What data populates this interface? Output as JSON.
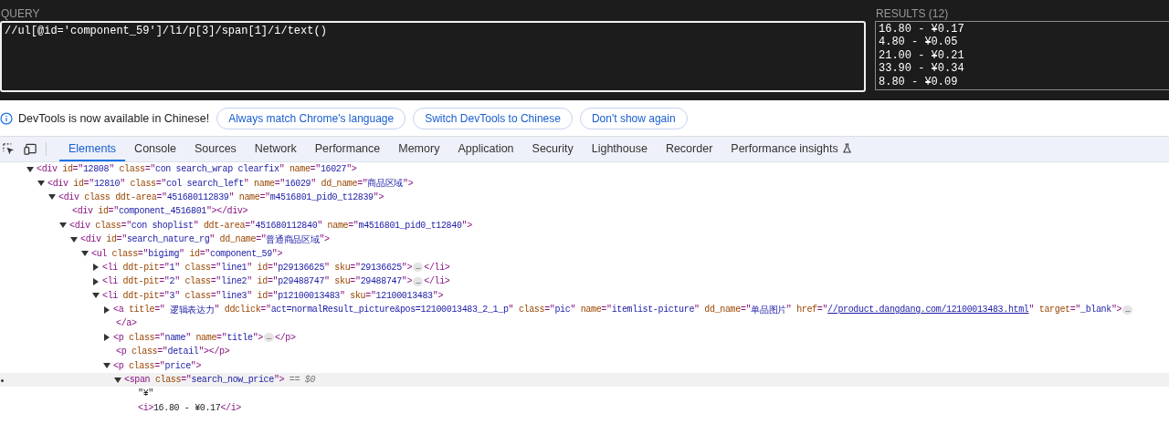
{
  "xpath_helper": {
    "query_label": "QUERY",
    "query": "//ul[@id='component_59']/li/p[3]/span[1]/i/text()",
    "results_label": "RESULTS (12)",
    "results": [
      "16.80 - ¥0.17",
      "4.80 - ¥0.05",
      "21.00 - ¥0.21",
      "33.90 - ¥0.34",
      "8.80 - ¥0.09"
    ]
  },
  "infobar": {
    "message": "DevTools is now available in Chinese!",
    "buttons": [
      "Always match Chrome's language",
      "Switch DevTools to Chinese",
      "Don't show again"
    ]
  },
  "tabs": [
    {
      "label": "Elements",
      "selected": true,
      "kind": "plain"
    },
    {
      "label": "Console",
      "selected": false,
      "kind": "plain"
    },
    {
      "label": "Sources",
      "selected": false,
      "kind": "plain"
    },
    {
      "label": "Network",
      "selected": false,
      "kind": "plain"
    },
    {
      "label": "Performance",
      "selected": false,
      "kind": "plain"
    },
    {
      "label": "Memory",
      "selected": false,
      "kind": "plain"
    },
    {
      "label": "Application",
      "selected": false,
      "kind": "plain"
    },
    {
      "label": "Security",
      "selected": false,
      "kind": "plain"
    },
    {
      "label": "Lighthouse",
      "selected": false,
      "kind": "plain"
    },
    {
      "label": "Recorder",
      "selected": false,
      "kind": "plain"
    },
    {
      "label": "Performance insights",
      "selected": false,
      "kind": "experimental"
    }
  ],
  "dom_tree": [
    {
      "expanded": true,
      "selected": false,
      "parts": [
        {
          "kind": "tag",
          "text": "<div"
        },
        {
          "kind": "attr",
          "text": " id"
        },
        {
          "kind": "punct",
          "text": "=\""
        },
        {
          "kind": "value",
          "text": "12808"
        },
        {
          "kind": "punct",
          "text": "\""
        },
        {
          "kind": "attr",
          "text": " class"
        },
        {
          "kind": "punct",
          "text": "=\""
        },
        {
          "kind": "value",
          "text": "con search_wrap clearfix"
        },
        {
          "kind": "punct",
          "text": "\""
        },
        {
          "kind": "attr",
          "text": " name"
        },
        {
          "kind": "punct",
          "text": "=\""
        },
        {
          "kind": "value",
          "text": "16027"
        },
        {
          "kind": "punct",
          "text": "\""
        },
        {
          "kind": "tag",
          "text": ">"
        }
      ],
      "children": [
        {
          "expanded": true,
          "selected": false,
          "parts": [
            {
              "kind": "tag",
              "text": "<div"
            },
            {
              "kind": "attr",
              "text": " id"
            },
            {
              "kind": "punct",
              "text": "=\""
            },
            {
              "kind": "value",
              "text": "12810"
            },
            {
              "kind": "punct",
              "text": "\""
            },
            {
              "kind": "attr",
              "text": " class"
            },
            {
              "kind": "punct",
              "text": "=\""
            },
            {
              "kind": "value",
              "text": "col search_left"
            },
            {
              "kind": "punct",
              "text": "\""
            },
            {
              "kind": "attr",
              "text": " name"
            },
            {
              "kind": "punct",
              "text": "=\""
            },
            {
              "kind": "value",
              "text": "16029"
            },
            {
              "kind": "punct",
              "text": "\""
            },
            {
              "kind": "attr",
              "text": " dd_name"
            },
            {
              "kind": "punct",
              "text": "=\""
            },
            {
              "kind": "value",
              "text": "商品区域"
            },
            {
              "kind": "punct",
              "text": "\""
            },
            {
              "kind": "tag",
              "text": ">"
            }
          ],
          "children": [
            {
              "expanded": true,
              "selected": false,
              "parts": [
                {
                  "kind": "tag",
                  "text": "<div"
                },
                {
                  "kind": "attr",
                  "text": " class ddt-area"
                },
                {
                  "kind": "punct",
                  "text": "=\""
                },
                {
                  "kind": "value",
                  "text": "451680112839"
                },
                {
                  "kind": "punct",
                  "text": "\""
                },
                {
                  "kind": "attr",
                  "text": " name"
                },
                {
                  "kind": "punct",
                  "text": "=\""
                },
                {
                  "kind": "value",
                  "text": "m4516801_pid0_t12839"
                },
                {
                  "kind": "punct",
                  "text": "\""
                },
                {
                  "kind": "tag",
                  "text": ">"
                }
              ],
              "children": [
                {
                  "selected": false,
                  "parts": [
                    {
                      "kind": "tag",
                      "text": "<div"
                    },
                    {
                      "kind": "attr",
                      "text": " id"
                    },
                    {
                      "kind": "punct",
                      "text": "=\""
                    },
                    {
                      "kind": "value",
                      "text": "component_4516801"
                    },
                    {
                      "kind": "punct",
                      "text": "\""
                    },
                    {
                      "kind": "tag",
                      "text": "></div>"
                    }
                  ]
                },
                {
                  "expanded": true,
                  "selected": false,
                  "parts": [
                    {
                      "kind": "tag",
                      "text": "<div"
                    },
                    {
                      "kind": "attr",
                      "text": " class"
                    },
                    {
                      "kind": "punct",
                      "text": "=\""
                    },
                    {
                      "kind": "value",
                      "text": "con shoplist"
                    },
                    {
                      "kind": "punct",
                      "text": "\""
                    },
                    {
                      "kind": "attr",
                      "text": " ddt-area"
                    },
                    {
                      "kind": "punct",
                      "text": "=\""
                    },
                    {
                      "kind": "value",
                      "text": "451680112840"
                    },
                    {
                      "kind": "punct",
                      "text": "\""
                    },
                    {
                      "kind": "attr",
                      "text": " name"
                    },
                    {
                      "kind": "punct",
                      "text": "=\""
                    },
                    {
                      "kind": "value",
                      "text": "m4516801_pid0_t12840"
                    },
                    {
                      "kind": "punct",
                      "text": "\""
                    },
                    {
                      "kind": "tag",
                      "text": ">"
                    }
                  ],
                  "children": [
                    {
                      "expanded": true,
                      "selected": false,
                      "parts": [
                        {
                          "kind": "tag",
                          "text": "<div"
                        },
                        {
                          "kind": "attr",
                          "text": " id"
                        },
                        {
                          "kind": "punct",
                          "text": "=\""
                        },
                        {
                          "kind": "value",
                          "text": "search_nature_rg"
                        },
                        {
                          "kind": "punct",
                          "text": "\""
                        },
                        {
                          "kind": "attr",
                          "text": " dd_name"
                        },
                        {
                          "kind": "punct",
                          "text": "=\""
                        },
                        {
                          "kind": "value",
                          "text": "普通商品区域"
                        },
                        {
                          "kind": "punct",
                          "text": "\""
                        },
                        {
                          "kind": "tag",
                          "text": ">"
                        }
                      ],
                      "children": [
                        {
                          "expanded": true,
                          "selected": false,
                          "parts": [
                            {
                              "kind": "tag",
                              "text": "<ul"
                            },
                            {
                              "kind": "attr",
                              "text": " class"
                            },
                            {
                              "kind": "punct",
                              "text": "=\""
                            },
                            {
                              "kind": "value",
                              "text": "bigimg"
                            },
                            {
                              "kind": "punct",
                              "text": "\""
                            },
                            {
                              "kind": "attr",
                              "text": " id"
                            },
                            {
                              "kind": "punct",
                              "text": "=\""
                            },
                            {
                              "kind": "value",
                              "text": "component_59"
                            },
                            {
                              "kind": "punct",
                              "text": "\""
                            },
                            {
                              "kind": "tag",
                              "text": ">"
                            }
                          ],
                          "children": [
                            {
                              "expanded": false,
                              "selected": false,
                              "parts": [
                                {
                                  "kind": "tag",
                                  "text": "<li"
                                },
                                {
                                  "kind": "attr",
                                  "text": " ddt-pit"
                                },
                                {
                                  "kind": "punct",
                                  "text": "=\""
                                },
                                {
                                  "kind": "value",
                                  "text": "1"
                                },
                                {
                                  "kind": "punct",
                                  "text": "\""
                                },
                                {
                                  "kind": "attr",
                                  "text": " class"
                                },
                                {
                                  "kind": "punct",
                                  "text": "=\""
                                },
                                {
                                  "kind": "value",
                                  "text": "line1"
                                },
                                {
                                  "kind": "punct",
                                  "text": "\""
                                },
                                {
                                  "kind": "attr",
                                  "text": " id"
                                },
                                {
                                  "kind": "punct",
                                  "text": "=\""
                                },
                                {
                                  "kind": "value",
                                  "text": "p29136625"
                                },
                                {
                                  "kind": "punct",
                                  "text": "\""
                                },
                                {
                                  "kind": "attr",
                                  "text": " sku"
                                },
                                {
                                  "kind": "punct",
                                  "text": "=\""
                                },
                                {
                                  "kind": "value",
                                  "text": "29136625"
                                },
                                {
                                  "kind": "punct",
                                  "text": "\""
                                },
                                {
                                  "kind": "tag",
                                  "text": ">"
                                },
                                {
                                  "kind": "ellipsis",
                                  "text": "…"
                                },
                                {
                                  "kind": "tag",
                                  "text": "</li>"
                                }
                              ]
                            },
                            {
                              "expanded": false,
                              "selected": false,
                              "parts": [
                                {
                                  "kind": "tag",
                                  "text": "<li"
                                },
                                {
                                  "kind": "attr",
                                  "text": " ddt-pit"
                                },
                                {
                                  "kind": "punct",
                                  "text": "=\""
                                },
                                {
                                  "kind": "value",
                                  "text": "2"
                                },
                                {
                                  "kind": "punct",
                                  "text": "\""
                                },
                                {
                                  "kind": "attr",
                                  "text": " class"
                                },
                                {
                                  "kind": "punct",
                                  "text": "=\""
                                },
                                {
                                  "kind": "value",
                                  "text": "line2"
                                },
                                {
                                  "kind": "punct",
                                  "text": "\""
                                },
                                {
                                  "kind": "attr",
                                  "text": " id"
                                },
                                {
                                  "kind": "punct",
                                  "text": "=\""
                                },
                                {
                                  "kind": "value",
                                  "text": "p29488747"
                                },
                                {
                                  "kind": "punct",
                                  "text": "\""
                                },
                                {
                                  "kind": "attr",
                                  "text": " sku"
                                },
                                {
                                  "kind": "punct",
                                  "text": "=\""
                                },
                                {
                                  "kind": "value",
                                  "text": "29488747"
                                },
                                {
                                  "kind": "punct",
                                  "text": "\""
                                },
                                {
                                  "kind": "tag",
                                  "text": ">"
                                },
                                {
                                  "kind": "ellipsis",
                                  "text": "…"
                                },
                                {
                                  "kind": "tag",
                                  "text": "</li>"
                                }
                              ]
                            },
                            {
                              "expanded": true,
                              "selected": false,
                              "parts": [
                                {
                                  "kind": "tag",
                                  "text": "<li"
                                },
                                {
                                  "kind": "attr",
                                  "text": " ddt-pit"
                                },
                                {
                                  "kind": "punct",
                                  "text": "=\""
                                },
                                {
                                  "kind": "value",
                                  "text": "3"
                                },
                                {
                                  "kind": "punct",
                                  "text": "\""
                                },
                                {
                                  "kind": "attr",
                                  "text": " class"
                                },
                                {
                                  "kind": "punct",
                                  "text": "=\""
                                },
                                {
                                  "kind": "value",
                                  "text": "line3"
                                },
                                {
                                  "kind": "punct",
                                  "text": "\""
                                },
                                {
                                  "kind": "attr",
                                  "text": " id"
                                },
                                {
                                  "kind": "punct",
                                  "text": "=\""
                                },
                                {
                                  "kind": "value",
                                  "text": "p12100013483"
                                },
                                {
                                  "kind": "punct",
                                  "text": "\""
                                },
                                {
                                  "kind": "attr",
                                  "text": " sku"
                                },
                                {
                                  "kind": "punct",
                                  "text": "=\""
                                },
                                {
                                  "kind": "value",
                                  "text": "12100013483"
                                },
                                {
                                  "kind": "punct",
                                  "text": "\""
                                },
                                {
                                  "kind": "tag",
                                  "text": ">"
                                }
                              ],
                              "children": [
                                {
                                  "expanded": false,
                                  "selected": false,
                                  "closing": "</a>",
                                  "parts": [
                                    {
                                      "kind": "tag",
                                      "text": "<a"
                                    },
                                    {
                                      "kind": "attr",
                                      "text": " title"
                                    },
                                    {
                                      "kind": "punct",
                                      "text": "=\""
                                    },
                                    {
                                      "kind": "value",
                                      "text": " 逻辑表达力"
                                    },
                                    {
                                      "kind": "punct",
                                      "text": "\""
                                    },
                                    {
                                      "kind": "attr",
                                      "text": " ddclick"
                                    },
                                    {
                                      "kind": "punct",
                                      "text": "=\""
                                    },
                                    {
                                      "kind": "value",
                                      "text": "act=normalResult_picture&pos=12100013483_2_1_p"
                                    },
                                    {
                                      "kind": "punct",
                                      "text": "\""
                                    },
                                    {
                                      "kind": "attr",
                                      "text": " class"
                                    },
                                    {
                                      "kind": "punct",
                                      "text": "=\""
                                    },
                                    {
                                      "kind": "value",
                                      "text": "pic"
                                    },
                                    {
                                      "kind": "punct",
                                      "text": "\""
                                    },
                                    {
                                      "kind": "attr",
                                      "text": " name"
                                    },
                                    {
                                      "kind": "punct",
                                      "text": "=\""
                                    },
                                    {
                                      "kind": "value",
                                      "text": "itemlist-picture"
                                    },
                                    {
                                      "kind": "punct",
                                      "text": "\""
                                    },
                                    {
                                      "kind": "attr",
                                      "text": " dd_name"
                                    },
                                    {
                                      "kind": "punct",
                                      "text": "=\""
                                    },
                                    {
                                      "kind": "value",
                                      "text": "单品图片"
                                    },
                                    {
                                      "kind": "punct",
                                      "text": "\""
                                    },
                                    {
                                      "kind": "attr",
                                      "text": " href"
                                    },
                                    {
                                      "kind": "punct",
                                      "text": "=\""
                                    },
                                    {
                                      "kind": "link",
                                      "text": "//product.dangdang.com/12100013483.html"
                                    },
                                    {
                                      "kind": "punct",
                                      "text": "\""
                                    },
                                    {
                                      "kind": "attr",
                                      "text": " target"
                                    },
                                    {
                                      "kind": "punct",
                                      "text": "=\""
                                    },
                                    {
                                      "kind": "value",
                                      "text": "_blank"
                                    },
                                    {
                                      "kind": "punct",
                                      "text": "\""
                                    },
                                    {
                                      "kind": "tag",
                                      "text": ">"
                                    },
                                    {
                                      "kind": "ellipsis",
                                      "text": "…"
                                    }
                                  ]
                                },
                                {
                                  "expanded": false,
                                  "selected": false,
                                  "parts": [
                                    {
                                      "kind": "tag",
                                      "text": "<p"
                                    },
                                    {
                                      "kind": "attr",
                                      "text": " class"
                                    },
                                    {
                                      "kind": "punct",
                                      "text": "=\""
                                    },
                                    {
                                      "kind": "value",
                                      "text": "name"
                                    },
                                    {
                                      "kind": "punct",
                                      "text": "\""
                                    },
                                    {
                                      "kind": "attr",
                                      "text": " name"
                                    },
                                    {
                                      "kind": "punct",
                                      "text": "=\""
                                    },
                                    {
                                      "kind": "value",
                                      "text": "title"
                                    },
                                    {
                                      "kind": "punct",
                                      "text": "\""
                                    },
                                    {
                                      "kind": "tag",
                                      "text": ">"
                                    },
                                    {
                                      "kind": "ellipsis",
                                      "text": "…"
                                    },
                                    {
                                      "kind": "tag",
                                      "text": "</p>"
                                    }
                                  ]
                                },
                                {
                                  "selected": false,
                                  "parts": [
                                    {
                                      "kind": "tag",
                                      "text": "<p"
                                    },
                                    {
                                      "kind": "attr",
                                      "text": " class"
                                    },
                                    {
                                      "kind": "punct",
                                      "text": "=\""
                                    },
                                    {
                                      "kind": "value",
                                      "text": "detail"
                                    },
                                    {
                                      "kind": "punct",
                                      "text": "\""
                                    },
                                    {
                                      "kind": "tag",
                                      "text": "></p>"
                                    }
                                  ]
                                },
                                {
                                  "expanded": true,
                                  "selected": false,
                                  "parts": [
                                    {
                                      "kind": "tag",
                                      "text": "<p"
                                    },
                                    {
                                      "kind": "attr",
                                      "text": " class"
                                    },
                                    {
                                      "kind": "punct",
                                      "text": "=\""
                                    },
                                    {
                                      "kind": "value",
                                      "text": "price"
                                    },
                                    {
                                      "kind": "punct",
                                      "text": "\""
                                    },
                                    {
                                      "kind": "tag",
                                      "text": ">"
                                    }
                                  ],
                                  "children": [
                                    {
                                      "expanded": true,
                                      "selected": true,
                                      "parts": [
                                        {
                                          "kind": "tag",
                                          "text": "<span"
                                        },
                                        {
                                          "kind": "attr",
                                          "text": " class"
                                        },
                                        {
                                          "kind": "punct",
                                          "text": "=\""
                                        },
                                        {
                                          "kind": "value",
                                          "text": "search_now_price"
                                        },
                                        {
                                          "kind": "punct",
                                          "text": "\""
                                        },
                                        {
                                          "kind": "tag",
                                          "text": ">"
                                        },
                                        {
                                          "kind": "hint",
                                          "text": " == $0"
                                        }
                                      ],
                                      "children": [
                                        {
                                          "selected": false,
                                          "parts": [
                                            {
                                              "kind": "text",
                                              "text": "\"¥\""
                                            }
                                          ]
                                        },
                                        {
                                          "selected": false,
                                          "parts": [
                                            {
                                              "kind": "tag",
                                              "text": "<i>"
                                            },
                                            {
                                              "kind": "text",
                                              "text": "16.80 - ¥0.17"
                                            },
                                            {
                                              "kind": "tag",
                                              "text": "</i>"
                                            }
                                          ]
                                        }
                                      ]
                                    }
                                  ]
                                }
                              ]
                            }
                          ]
                        }
                      ]
                    }
                  ]
                }
              ]
            }
          ]
        }
      ]
    }
  ]
}
